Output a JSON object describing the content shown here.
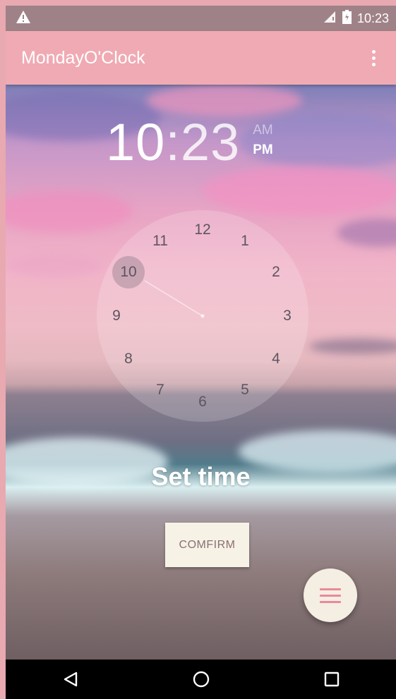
{
  "status_bar": {
    "time": "10:23",
    "icons": [
      "warning-icon",
      "signal-icon",
      "battery-icon"
    ]
  },
  "app_bar": {
    "title": "MondayO'Clock",
    "menu_icon": "overflow-menu-icon"
  },
  "time_picker": {
    "hour": "10",
    "separator": ":",
    "minute": "23",
    "am_label": "AM",
    "pm_label": "PM",
    "selected_period": "PM",
    "selected_hour": "10",
    "clock_numbers": [
      "12",
      "1",
      "2",
      "3",
      "4",
      "5",
      "6",
      "7",
      "8",
      "9",
      "10",
      "11"
    ]
  },
  "main": {
    "set_time_label": "Set time",
    "confirm_label": "COMFIRM"
  },
  "fab": {
    "icon": "menu-icon"
  },
  "navigation": {
    "icons": [
      "back-icon",
      "home-icon",
      "recents-icon"
    ]
  },
  "colors": {
    "app_bar": "#f0aab3",
    "status_bar": "#9f8287",
    "confirm_bg": "#f7f2e6",
    "fab_icon": "#e98a99"
  }
}
